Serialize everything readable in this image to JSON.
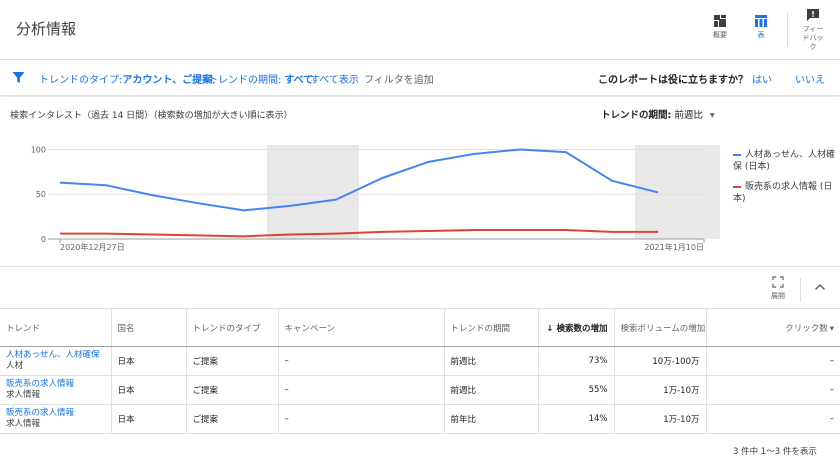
{
  "header": {
    "title": "分析情報",
    "buttons": [
      {
        "label": "概要",
        "icon": "overview-icon"
      },
      {
        "label": "表",
        "icon": "table-icon"
      },
      {
        "label": "フィードバック",
        "label_lines": [
          "フィー",
          "ドバッ",
          "ク"
        ],
        "icon": "feedback-icon"
      }
    ]
  },
  "filter": {
    "type_label": "トレンドのタイプ:",
    "type_value": "アカウント、ご提案",
    "sep": ",",
    "period_label": "トレンドの期間:",
    "period_value": "すべて",
    "show_all": "すべて表示",
    "add_filter": "フィルタを追加",
    "question": "このレポートは役に立ちますか？",
    "yes": "はい",
    "no": "いいえ"
  },
  "chart_header": {
    "title": "検索インタレスト（過去 14 日間）（検索数の増加が大きい順に表示）",
    "period_label": "トレンドの期間:",
    "period_value": "前週比"
  },
  "chart_data": {
    "type": "line",
    "x": [
      "2020年12月27日",
      "2020年12月28日",
      "2020年12月29日",
      "2020年12月30日",
      "2020年12月31日",
      "2021年1月1日",
      "2021年1月2日",
      "2021年1月3日",
      "2021年1月4日",
      "2021年1月5日",
      "2021年1月6日",
      "2021年1月7日",
      "2021年1月8日",
      "2021年1月9日",
      "2021年1月10日"
    ],
    "x_tick_labels": [
      "2020年12月27日",
      "2021年1月10日"
    ],
    "shaded_ranges": [
      [
        5,
        6
      ],
      [
        13,
        14
      ]
    ],
    "series": [
      {
        "name": "人材あっせん、人材確保 (日本)",
        "color": "#4285f4",
        "values": [
          63,
          60,
          49,
          40,
          32,
          37,
          44,
          68,
          86,
          95,
          100,
          97,
          65,
          52
        ]
      },
      {
        "name": "販売系の求人情報 (日本)",
        "color": "#db4437",
        "values": [
          6,
          6,
          5,
          4,
          3,
          5,
          6,
          8,
          9,
          10,
          10,
          10,
          8,
          8
        ]
      }
    ],
    "yticks": [
      0,
      50,
      100
    ],
    "ylim": [
      0,
      105
    ],
    "grid": true,
    "legend_position": "right"
  },
  "toolbar2": {
    "expand_label": "展開"
  },
  "table": {
    "columns": [
      "トレンド",
      "国名",
      "トレンドのタイプ",
      "キャンペーン",
      "トレンドの期間",
      "検索数の増加",
      "検索ボリュームの増加",
      "クリック数"
    ],
    "sort_arrow": "↓",
    "rows": [
      {
        "trend": "人材あっせん、人材確保",
        "sub": "人材",
        "country": "日本",
        "type": "ご提案",
        "campaign": "–",
        "period": "前週比",
        "increase": "73%",
        "volume": "10万-100万",
        "clicks": "–"
      },
      {
        "trend": "販売系の求人情報",
        "sub": "求人情報",
        "country": "日本",
        "type": "ご提案",
        "campaign": "–",
        "period": "前週比",
        "increase": "55%",
        "volume": "1万-10万",
        "clicks": "–"
      },
      {
        "trend": "販売系の求人情報",
        "sub": "求人情報",
        "country": "日本",
        "type": "ご提案",
        "campaign": "–",
        "period": "前年比",
        "increase": "14%",
        "volume": "1万-10万",
        "clicks": "–"
      }
    ]
  },
  "pager": "3 件中 1～3 件を表示"
}
